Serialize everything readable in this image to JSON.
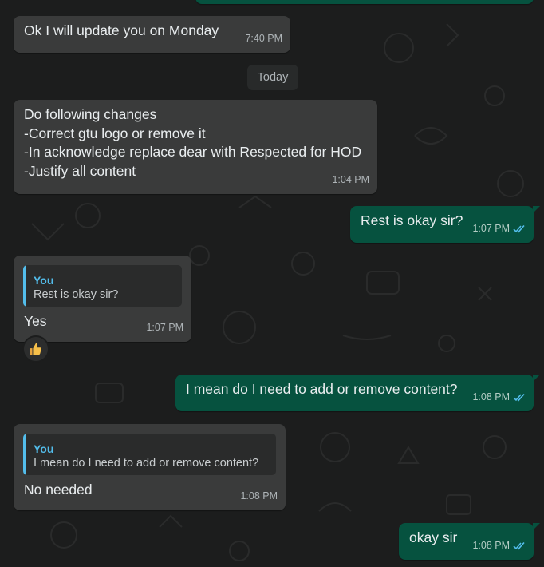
{
  "chat": {
    "date_separator": "Today",
    "messages": [
      {
        "direction": "incoming",
        "text": "Ok I will update you on Monday",
        "time": "7:40 PM"
      },
      {
        "direction": "incoming",
        "text": "Do following changes\n-Correct gtu logo or remove it\n-In acknowledge replace dear with Respected for HOD\n-Justify all content",
        "time": "1:04 PM"
      },
      {
        "direction": "outgoing",
        "text": "Rest is okay sir?",
        "time": "1:07 PM",
        "status": "read"
      },
      {
        "direction": "incoming",
        "quote_author": "You",
        "quote_text": "Rest is okay sir?",
        "text": "Yes",
        "time": "1:07 PM",
        "reaction": "thumbs-up"
      },
      {
        "direction": "outgoing",
        "text": "I mean do I need to add or remove content?",
        "time": "1:08 PM",
        "status": "read"
      },
      {
        "direction": "incoming",
        "quote_author": "You",
        "quote_text": "I mean do I need to add or remove content?",
        "text": "No needed",
        "time": "1:08 PM"
      },
      {
        "direction": "outgoing",
        "text": "okay sir",
        "time": "1:08 PM",
        "status": "read"
      }
    ]
  },
  "colors": {
    "background": "#1c1d1d",
    "incoming_bubble": "#3a3b3b",
    "outgoing_bubble": "#06523f",
    "quote_accent": "#53bdeb",
    "read_ticks": "#53bdeb"
  }
}
